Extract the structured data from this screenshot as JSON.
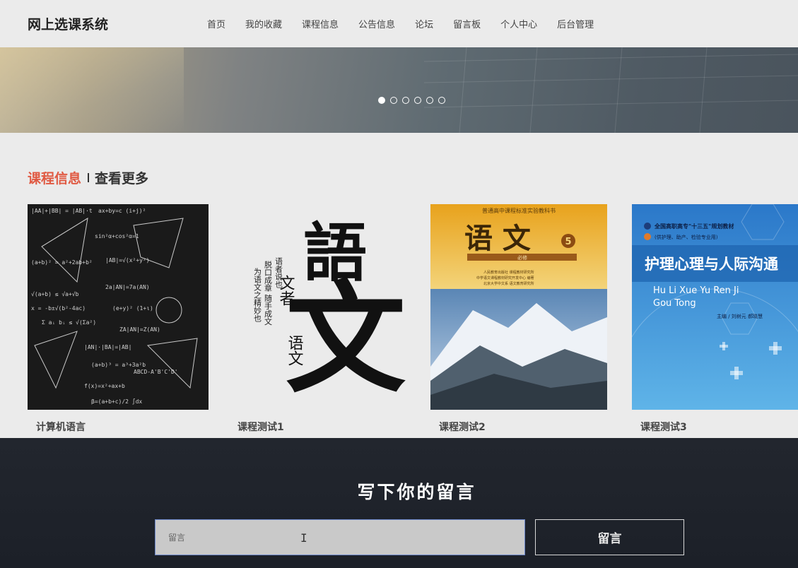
{
  "header": {
    "brand": "网上选课系统",
    "nav": [
      "首页",
      "我的收藏",
      "课程信息",
      "公告信息",
      "论坛",
      "留言板",
      "个人中心",
      "后台管理"
    ]
  },
  "banner": {
    "slides_total": 6,
    "active_slide": 1
  },
  "section": {
    "title": "课程信息",
    "more": "查看更多"
  },
  "cards": [
    {
      "title": "计算机语言",
      "image": "chalkboard-math-image"
    },
    {
      "title": "课程测试1",
      "image": "calligraphy-yuwen-image",
      "image_text": {
        "big1": "語",
        "big2": "文",
        "small": "文者",
        "small2": "语文"
      }
    },
    {
      "title": "课程测试2",
      "image": "textbook-cover-yuwen-image",
      "image_text": {
        "top": "普通高中课程标准实验教科书",
        "title": "语 文",
        "vol": "5",
        "sub": "必修"
      }
    },
    {
      "title": "课程测试3",
      "image": "textbook-cover-nursing-image",
      "image_text": {
        "series": "全国高职高专\"十三五\"规划教材",
        "use": "(供护理、助产、检验专业用)",
        "title": "护理心理与人际沟通",
        "pinyin1": "Hu Li Xue Yu Ren Ji",
        "pinyin2": "Gou Tong",
        "authors": "主编 / 刘树元  郝晓慧"
      }
    }
  ],
  "footer": {
    "title": "写下你的留言",
    "input_placeholder": "留言",
    "button_label": "留言"
  },
  "colors": {
    "accent": "#e05a43",
    "footer_bg": "#1f232b",
    "page_bg": "#ebebeb"
  }
}
